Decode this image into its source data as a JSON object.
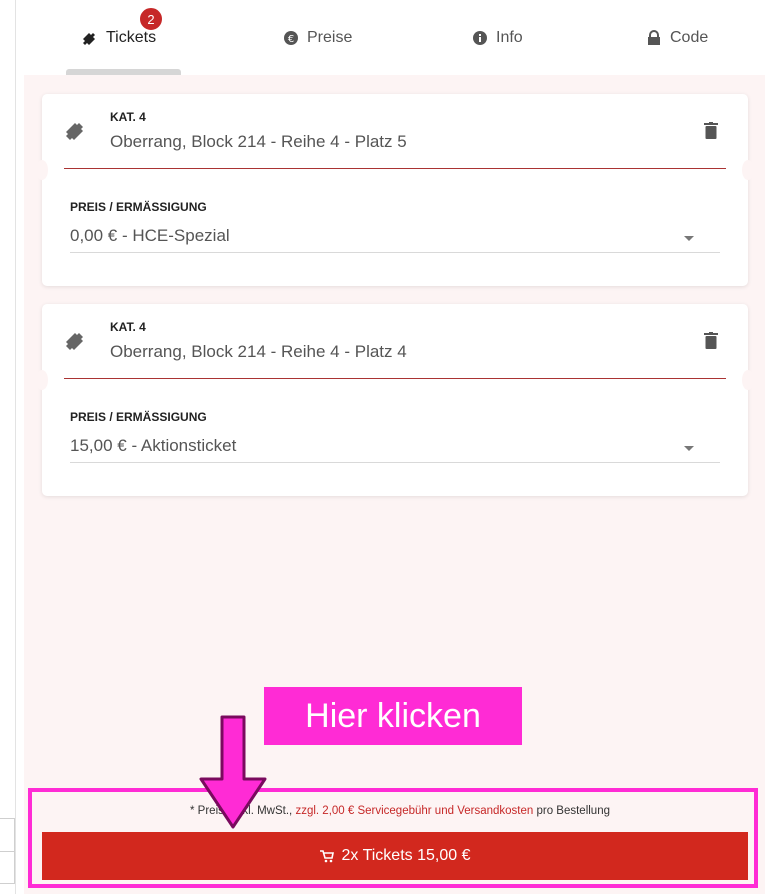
{
  "tabs": [
    {
      "label": "Tickets",
      "icon": "ticket-icon",
      "active": true
    },
    {
      "label": "Preise",
      "icon": "euro-icon"
    },
    {
      "label": "Info",
      "icon": "info-icon"
    },
    {
      "label": "Code",
      "icon": "lock-icon"
    }
  ],
  "cart_count": "2",
  "tickets": [
    {
      "category": "KAT. 4",
      "seat": "Oberrang, Block 214 - Reihe 4 - Platz 5",
      "price_label": "PREIS / ERMÄSSIGUNG",
      "price_value": "0,00 € - HCE-Spezial"
    },
    {
      "category": "KAT. 4",
      "seat": "Oberrang, Block 214 - Reihe 4 - Platz 4",
      "price_label": "PREIS / ERMÄSSIGUNG",
      "price_value": "15,00 € - Aktionsticket"
    }
  ],
  "callout": "Hier klicken",
  "footer": {
    "note_prefix": "* Preise inkl. MwSt., ",
    "note_link": "zzgl. 2,00 € Servicegebühr und Versandkosten",
    "note_suffix": " pro Bestellung",
    "checkout_label": "2x Tickets 15,00 €"
  },
  "colors": {
    "accent": "#d2281e",
    "highlight": "#ff2bd5",
    "background": "#fdf4f4"
  }
}
